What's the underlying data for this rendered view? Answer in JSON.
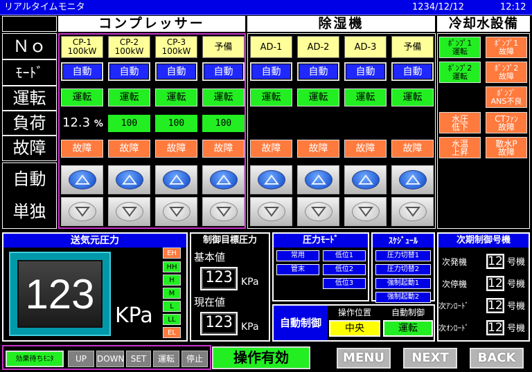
{
  "titlebar": {
    "title": "リアルタイムモニタ",
    "date": "1234/12/12",
    "time": "12:12"
  },
  "sections": {
    "compressor": "コンプレッサー",
    "dehumidifier": "除湿機",
    "cooling": "冷却水設備"
  },
  "row_labels": {
    "no": "Ｎｏ",
    "mode": "ﾓｰﾄﾞ",
    "run": "運転",
    "load": "負荷",
    "fault": "故障",
    "auto": "自動",
    "single": "単独"
  },
  "compressors": [
    {
      "no": "CP-1\n100kW",
      "mode": "自動",
      "run": "運転",
      "load": "12.3",
      "fault": "故障"
    },
    {
      "no": "CP-2\n100kW",
      "mode": "自動",
      "run": "運転",
      "load": "100",
      "fault": "故障"
    },
    {
      "no": "CP-3\n100kW",
      "mode": "自動",
      "run": "運転",
      "load": "100",
      "fault": "故障"
    },
    {
      "no": "予備",
      "mode": "自動",
      "run": "運転",
      "load": "100",
      "fault": "故障"
    }
  ],
  "load_unit": "%",
  "dehumidifiers": [
    {
      "no": "AD-1",
      "mode": "自動",
      "run": "運転",
      "fault": "故障"
    },
    {
      "no": "AD-2",
      "mode": "自動",
      "run": "運転",
      "fault": "故障"
    },
    {
      "no": "AD-3",
      "mode": "自動",
      "run": "運転",
      "fault": "故障"
    },
    {
      "no": "予備",
      "mode": "自動",
      "run": "運転",
      "fault": "故障"
    }
  ],
  "cooling": {
    "pump1_run": "ﾎﾟﾝﾌﾟ1\n運転",
    "pump1_fault": "ﾎﾟﾝﾌﾟ1\n故障",
    "pump2_run": "ﾎﾟﾝﾌﾟ2\n運転",
    "pump2_fault": "ﾎﾟﾝﾌﾟ2\n故障",
    "pump_ans": "ﾎﾟﾝﾌﾟ\nANS不良",
    "water_pressure": "水圧\n低下",
    "ct_fan": "CTﾌｧﾝ\n故障",
    "water_temp": "水温\n上昇",
    "spray_pump": "散水P\n故障"
  },
  "source_pressure": {
    "title": "送気元圧力",
    "value": "123",
    "unit": "KPa",
    "levels": [
      "EH",
      "HH",
      "H",
      "M",
      "L",
      "LL",
      "EL"
    ],
    "level_colors": {
      "EH": "#ff7a3d",
      "HH": "#22ee22",
      "H": "#22ee22",
      "M": "#22ee22",
      "L": "#22ee22",
      "LL": "#22ee22",
      "EL": "#ff7a3d"
    }
  },
  "control_target": {
    "title": "制御目標圧力",
    "base_label": "基本値",
    "base_value": "123",
    "current_label": "現在値",
    "current_value": "123",
    "unit": "KPa"
  },
  "pressure_mode": {
    "title": "圧力ﾓｰﾄﾞ",
    "buttons": [
      "常用",
      "低位1",
      "管末",
      "低位2",
      "低位3"
    ]
  },
  "schedule": {
    "title": "ｽｹｼﾞｭｰﾙ",
    "buttons": [
      "圧力切替1",
      "圧力切替2",
      "強制起動1",
      "強制起動2"
    ]
  },
  "auto_control": {
    "label": "自動制御",
    "position_label": "操作位置",
    "position_value": "中央",
    "control_label": "自動制御",
    "control_value": "運転"
  },
  "next_control": {
    "title": "次期制御号機",
    "rows": [
      {
        "label": "次発機",
        "value": "12",
        "unit": "号機"
      },
      {
        "label": "次停機",
        "value": "12",
        "unit": "号機"
      },
      {
        "label": "次ｱﾝﾛｰﾄﾞ",
        "value": "12",
        "unit": "号機"
      },
      {
        "label": "次ｵﾝﾛｰﾄﾞ",
        "value": "12",
        "unit": "号機"
      }
    ]
  },
  "footer": {
    "effect_wait": "効果待ちﾓﾆﾀ",
    "up": "UP",
    "down": "DOWN",
    "set": "SET",
    "run": "運転",
    "stop": "停止",
    "operation_enabled": "操作有効",
    "menu": "MENU",
    "next": "NEXT",
    "back": "BACK"
  },
  "colors": {
    "accent_blue": "#0000e6",
    "run_green": "#22ee22",
    "fault_orange": "#ff7a3d",
    "label_yellow": "#ffff99",
    "magenta_frame": "#cc33cc"
  }
}
